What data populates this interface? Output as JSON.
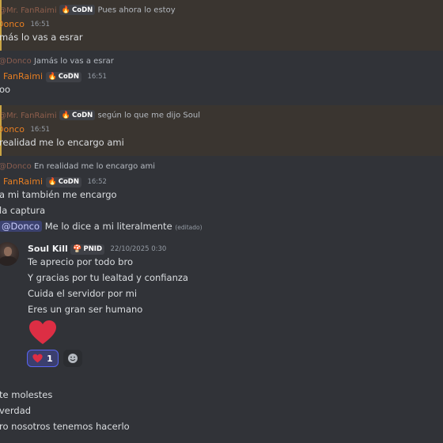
{
  "colors": {
    "background": "#313338",
    "mention_highlight": "#3a3530",
    "username_orange": "#e67e22",
    "reaction_accent": "#5865f2"
  },
  "role_tag": "CoDN",
  "messages": [
    {
      "reply_author": "@Mr. FanRaimi",
      "reply_text": "Pues ahora lo estoy"
    },
    {
      "author": "Donco",
      "time": "16:51",
      "text": "más lo vas a esrar"
    },
    {
      "reply_author": "@Donco",
      "reply_text": "Jamás lo vas a esrar"
    },
    {
      "author": "FanRaimi",
      "time": "16:51",
      "text": "oo"
    },
    {
      "reply_author": "@Mr. FanRaimi",
      "reply_text": "según lo que me dijo Soul"
    },
    {
      "author": "Donco",
      "time": "16:51",
      "text": "realidad me lo encargo ami"
    },
    {
      "reply_author": "@Donco",
      "reply_text": "En realidad me lo encargo ami"
    },
    {
      "author": "FanRaimi",
      "time": "16:52",
      "text": "a mi también me encargo"
    },
    {
      "text": "la captura"
    },
    {
      "mention": "@Donco",
      "text": "Me lo dice a mi literalmente",
      "edited": "(editado)"
    }
  ],
  "soul_message": {
    "author": "Soul Kill",
    "badge": "PNID",
    "time": "22/10/2025 0:30",
    "lines": [
      "Te aprecio por todo bro",
      "Y gracias por tu lealtad y confianza",
      "Cuida el servidor por mi",
      "Eres un gran ser humano"
    ],
    "emoji": "heart-emoji",
    "reaction": {
      "emoji": "heart",
      "count": "1"
    }
  },
  "bottom_lines": [
    "te molestes",
    "verdad",
    "ro nosotros tenemos hacerlo"
  ]
}
